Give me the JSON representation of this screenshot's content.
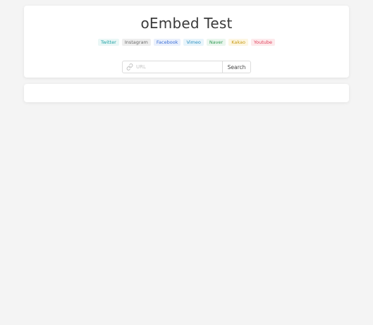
{
  "header": {
    "title": "oEmbed Test"
  },
  "tags": [
    {
      "label": "Twitter",
      "color": "#1da1a5",
      "bg": "#eaf7f6"
    },
    {
      "label": "Instagram",
      "color": "#6b6b6b",
      "bg": "#eeeeee"
    },
    {
      "label": "Facebook",
      "color": "#3b6fd6",
      "bg": "#eaf0fc"
    },
    {
      "label": "Vimeo",
      "color": "#2a8fbf",
      "bg": "#e8f4fb"
    },
    {
      "label": "Naver",
      "color": "#2e9a52",
      "bg": "#eaf6ee"
    },
    {
      "label": "Kakao",
      "color": "#c79a12",
      "bg": "#fdf6e2"
    },
    {
      "label": "Youtube",
      "color": "#e0405a",
      "bg": "#fdeaec"
    }
  ],
  "search": {
    "placeholder": "URL",
    "value": "",
    "button_label": "Search",
    "icon": "link-icon"
  }
}
